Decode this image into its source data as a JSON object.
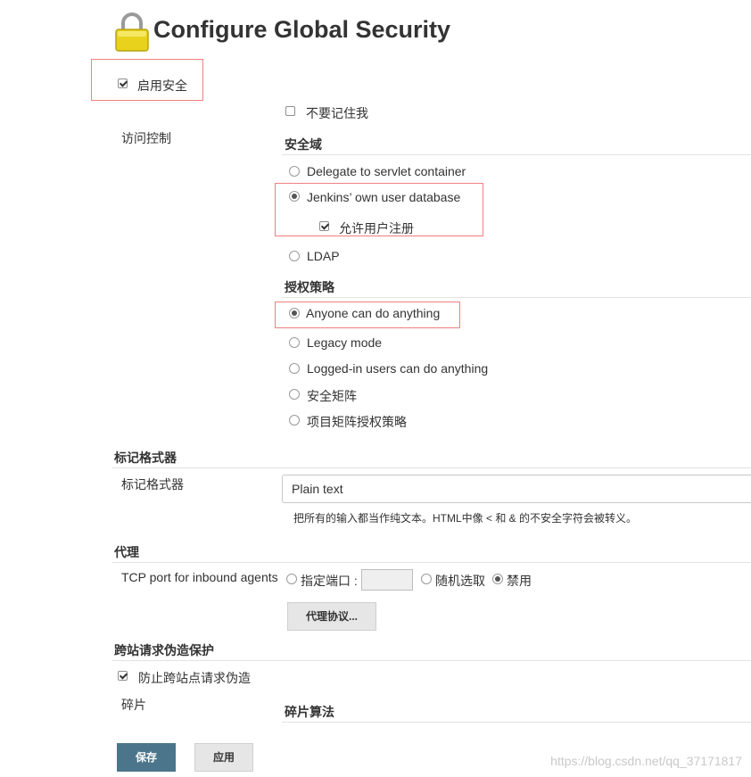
{
  "page": {
    "title": "Configure Global Security"
  },
  "enable_security": {
    "label": "启用安全",
    "checked": true
  },
  "access_control": {
    "label": "访问控制",
    "remember_me": {
      "label": "不要记住我",
      "checked": false
    },
    "security_realm": {
      "heading": "安全域",
      "options": [
        {
          "label": "Delegate to servlet container",
          "selected": false
        },
        {
          "label": "Jenkins’ own user database",
          "selected": true
        },
        {
          "label": "LDAP",
          "selected": false
        }
      ],
      "allow_signup": {
        "label": "允许用户注册",
        "checked": true
      }
    },
    "authorization": {
      "heading": "授权策略",
      "options": [
        {
          "label": "Anyone can do anything",
          "selected": true
        },
        {
          "label": "Legacy mode",
          "selected": false
        },
        {
          "label": "Logged-in users can do anything",
          "selected": false
        },
        {
          "label": "安全矩阵",
          "selected": false
        },
        {
          "label": "项目矩阵授权策略",
          "selected": false
        }
      ]
    }
  },
  "markup_formatter": {
    "heading": "标记格式器",
    "label": "标记格式器",
    "selected": "Plain text",
    "help": "把所有的输入都当作纯文本。HTML中像 < 和 & 的不安全字符会被转义。"
  },
  "agents": {
    "heading": "代理",
    "tcp_label": "TCP port for inbound agents",
    "options": [
      {
        "label": "指定端口 :",
        "selected": false
      },
      {
        "label": "随机选取",
        "selected": false
      },
      {
        "label": "禁用",
        "selected": true
      }
    ],
    "port_value": "",
    "protocols_button": "代理协议..."
  },
  "csrf": {
    "heading": "跨站请求伪造保护",
    "prevent": {
      "label": "防止跨站点请求伪造",
      "checked": true
    },
    "crumb_label": "碎片",
    "crumb_algorithm_heading": "碎片算法"
  },
  "buttons": {
    "save": "保存",
    "apply": "应用"
  },
  "watermark": "https://blog.csdn.net/qq_37171817",
  "colors": {
    "highlight": "#f08080",
    "save_button": "#4b758b"
  }
}
